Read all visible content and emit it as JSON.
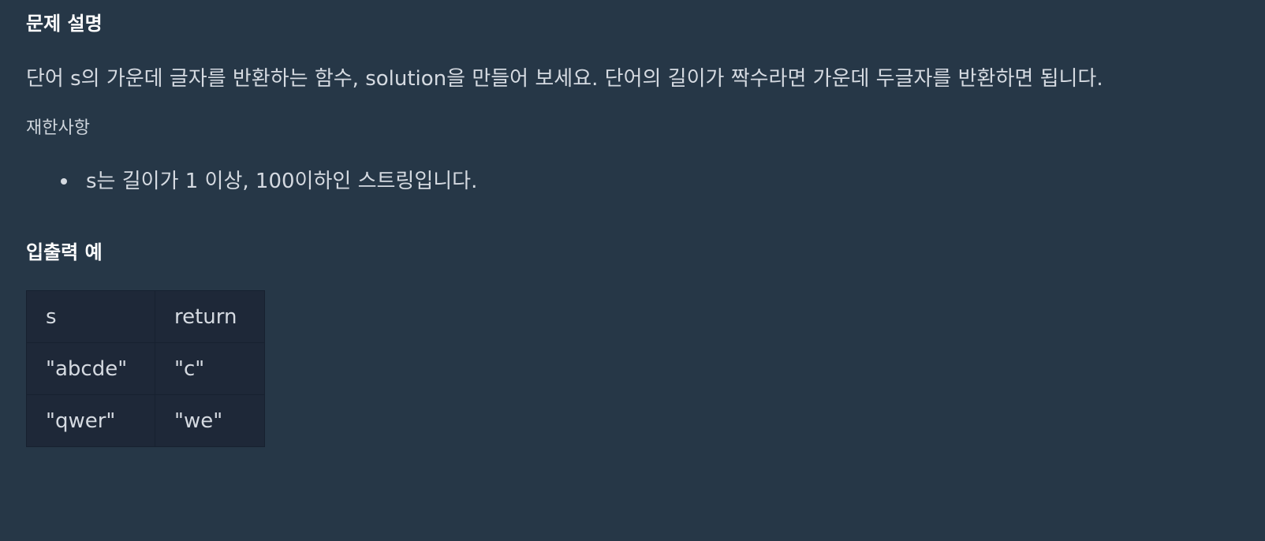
{
  "problem": {
    "title": "문제 설명",
    "description": "단어 s의 가운데 글자를 반환하는 함수, solution을 만들어 보세요. 단어의 길이가 짝수라면 가운데 두글자를 반환하면 됩니다.",
    "constraints_title": "재한사항",
    "constraints": [
      "s는 길이가 1 이상, 100이하인 스트링입니다."
    ]
  },
  "examples": {
    "title": "입출력 예",
    "headers": [
      "s",
      "return"
    ],
    "rows": [
      [
        "\"abcde\"",
        "\"c\""
      ],
      [
        "\"qwer\"",
        "\"we\""
      ]
    ]
  },
  "colors": {
    "background": "#263747",
    "table_background": "#1e2838",
    "title_text": "#ffffff",
    "body_text": "#d5dae1"
  }
}
